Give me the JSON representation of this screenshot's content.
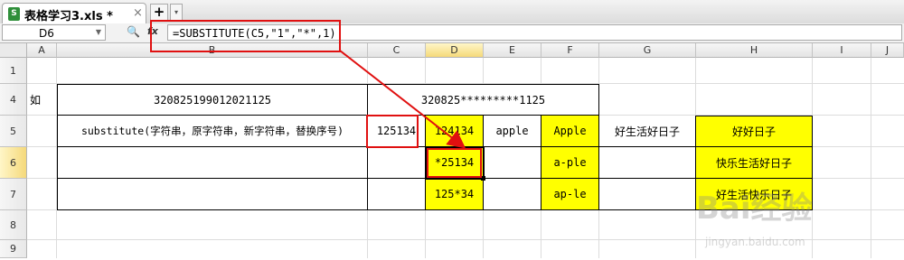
{
  "tab": {
    "title": "表格学习3.xls *",
    "close": "×",
    "add": "+",
    "menu": "▾"
  },
  "formula_bar": {
    "name_box": "D6",
    "formula": "=SUBSTITUTE(C5,\"1\",\"*\",1)"
  },
  "columns": [
    "A",
    "B",
    "C",
    "D",
    "E",
    "F",
    "G",
    "H",
    "I",
    "J"
  ],
  "rows": [
    "1",
    "4",
    "5",
    "6",
    "7",
    "8",
    "9"
  ],
  "cells": {
    "A4": "如",
    "B4": "320825199012021125",
    "D4": "320825*********1125",
    "B5": "substitute(字符串，原字符串，新字符串，替换序号)",
    "C5": "125134",
    "D5": "124134",
    "E5": "apple",
    "F5": "Apple",
    "G5": "好生活好日子",
    "H5": "好好日子",
    "D6": "*25134",
    "F6": "a-ple",
    "H6": "快乐生活好日子",
    "D7": "125*34",
    "F7": "ap-le",
    "H7": "好生活快乐日子"
  },
  "watermark": {
    "logo": "Bai经验",
    "url": "jingyan.baidu.com"
  },
  "colors": {
    "highlight": "#ffff00",
    "annotation": "#e01010"
  }
}
